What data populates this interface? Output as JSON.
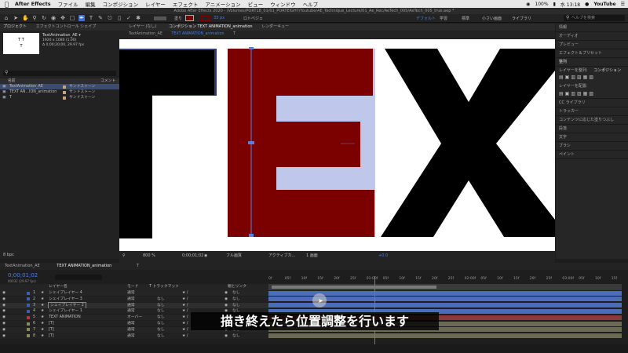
{
  "menubar": {
    "app": "After Effects",
    "items": [
      "ファイル",
      "編集",
      "コンポジション",
      "レイヤー",
      "エフェクト",
      "アニメーション",
      "ビュー",
      "ウィンドウ",
      "ヘルプ"
    ],
    "battery": "100%",
    "clock": "水 13:18",
    "youtube": "YouTube"
  },
  "window_title": "Adobe After Effects 2020 - /Volumes/PORT18_01/01_PORTEIGHT/Youtube/AE_Technique_Lecture/01_Ae_Rec/AeTech_005/AeTech_005_true.aep *",
  "toolbar": {
    "snap_label": "スナップ",
    "px_value": "33 px",
    "rotobrush": "ロトベジェ",
    "workspace_default": "デフォルト",
    "workspaces": [
      "学習",
      "標準",
      "小さい画面",
      "ライブラリ"
    ],
    "help_search": "ヘルプを検索"
  },
  "project": {
    "tab1": "プロジェクト",
    "tab2": "エフェクトコントロール シェイプ",
    "thumb_text": "T T\nT",
    "selected_name": "TextAnimation_AE ▾",
    "selected_info1": "1920 x 1080 (1.00)",
    "selected_info2": "Δ 0;00;20;00, 29.97 fps",
    "search_placeholder": "",
    "col_name": "名前",
    "col_comment": "コメント",
    "items": [
      {
        "name": "TextAnimation_AE",
        "type": "サンドストーン",
        "color": "#c8a27a"
      },
      {
        "name": "TEXT AN...ION_animation",
        "type": "サンドストーン",
        "color": "#c8a27a"
      },
      {
        "name": "T",
        "type": "サンドストーン",
        "color": "#c8a27a"
      }
    ],
    "bpc": "8 bpc"
  },
  "comp_panel": {
    "layer_tab": "レイヤー (なし)",
    "comp_tab": "コンポジション TEXT ANIMATION_animation",
    "render_tab": "レンダーキュー",
    "breadcrumb1": "TextAnimation_AE",
    "breadcrumb2": "TEXT ANIMATION_animation",
    "breadcrumb3": "T",
    "zoom": "800 %",
    "timecode": "0;00;01;02",
    "quality": "フル画質",
    "camera": "アクティブカ...",
    "views": "1 画面",
    "exposure": "+0.0"
  },
  "viewer_letters": [
    "T",
    "E",
    "X"
  ],
  "right_panel": {
    "items": [
      "情報",
      "オーディオ",
      "プレビュー",
      "エフェクト＆プリセット",
      "整列",
      "レイヤーを整列:",
      "レイヤーを配置:",
      "CC ライブラリ",
      "トラッカー",
      "コンテンツに応じた塗りつぶし",
      "段落",
      "文字",
      "ブラシ",
      "ペイント"
    ],
    "align_to": "コンポジション"
  },
  "timeline": {
    "tab1": "TextAnimation_AE",
    "tab2": "TEXT ANIMATION_animation",
    "tab3": "T",
    "timecode": "0;00;01;02",
    "fps": "00032 (29.97 fps)",
    "col_layername": "レイヤー名",
    "col_mode": "モード",
    "col_trkmat": "T トラックマット",
    "col_parent": "親とリンク",
    "ruler": [
      "0f",
      "05f",
      "10f",
      "15f",
      "20f",
      "25f",
      "01:00f",
      "05f",
      "10f",
      "15f",
      "20f",
      "25f",
      "02:00f",
      "05f",
      "10f",
      "15f",
      "20f",
      "25f",
      "03:00f",
      "05f",
      "10f",
      "15f"
    ],
    "layers": [
      {
        "num": "1",
        "name": "シェイプレイヤー 4",
        "mode": "通常",
        "mat": "",
        "parent": "なし",
        "bar": "#4a6fb8",
        "label": "#3a5fb0"
      },
      {
        "num": "2",
        "name": "シェイプレイヤー 3",
        "mode": "通常",
        "mat": "なし",
        "parent": "なし",
        "bar": "#4a6fb8",
        "label": "#3a5fb0"
      },
      {
        "num": "3",
        "name": "シェイプレイヤー 2",
        "mode": "通常",
        "mat": "なし",
        "parent": "なし",
        "bar": "#4a6fb8",
        "label": "#3a5fb0"
      },
      {
        "num": "4",
        "name": "シェイプレイヤー 1",
        "mode": "通常",
        "mat": "なし",
        "parent": "なし",
        "bar": "#4a6fb8",
        "label": "#3a5fb0"
      },
      {
        "num": "5",
        "name": "TEXT ANIMATION",
        "mode": "オーバー",
        "mat": "なし",
        "parent": "なし",
        "bar": "#8a3a3a",
        "label": "#b03a3a"
      },
      {
        "num": "6",
        "name": "[T]",
        "mode": "通常",
        "mat": "なし",
        "parent": "なし",
        "bar": "#6a6a55",
        "label": "#8a8a60"
      },
      {
        "num": "7",
        "name": "[T]",
        "mode": "通常",
        "mat": "なし",
        "parent": "なし",
        "bar": "#6a6a55",
        "label": "#8a8a60"
      },
      {
        "num": "8",
        "name": "[T]",
        "mode": "通常",
        "mat": "なし",
        "parent": "なし",
        "bar": "#6a6a55",
        "label": "#8a8a60"
      }
    ]
  },
  "subtitle": "描き終えたら位置調整を行います",
  "colors": {
    "red_letter": "#7b0000",
    "accent_blue": "#4a7fe0"
  }
}
